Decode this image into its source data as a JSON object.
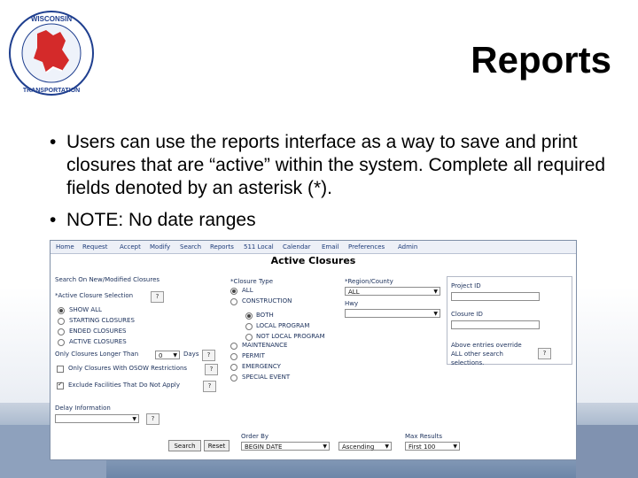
{
  "slide": {
    "title": "Reports",
    "bullets": [
      "Users can use the reports interface as a way to save and print closures that are “active” within the system. Complete all required fields denoted by an asterisk (*).",
      "NOTE:  No date ranges"
    ],
    "logo": {
      "text": "WISCONSIN DEPARTMENT OF TRANSPORTATION",
      "colors": {
        "state": "#d42a2a",
        "ring": "#1f3f8f"
      }
    }
  },
  "app": {
    "nav": [
      "Home",
      "Request",
      "Accept",
      "Modify",
      "Search",
      "Reports",
      "511 Local",
      "Calendar",
      "Email",
      "Preferences",
      "Admin"
    ],
    "page_title": "Active Closures",
    "search_on_label": "Search On New/Modified Closures",
    "active_selection_label": "*Active Closure Selection",
    "closure_options": [
      "SHOW ALL",
      "STARTING CLOSURES",
      "ENDED CLOSURES",
      "ACTIVE CLOSURES"
    ],
    "longer_than_label": "Only Closures Longer Than",
    "longer_than_value": "0",
    "days_label": "Days",
    "osow_label": "Only Closures With OSOW Restrictions",
    "exclude_label": "Exclude Facilities That Do Not Apply",
    "delay_label": "Delay Information",
    "search_button": "Search",
    "reset_button": "Reset",
    "closure_type_label": "*Closure Type",
    "closure_types": [
      "ALL",
      "CONSTRUCTION"
    ],
    "construction_sub": [
      "BOTH",
      "LOCAL PROGRAM",
      "NOT LOCAL PROGRAM"
    ],
    "other_types": [
      "MAINTENANCE",
      "PERMIT",
      "EMERGENCY",
      "SPECIAL EVENT"
    ],
    "region_label": "*Region/County",
    "region_value": "ALL",
    "hwy_label": "Hwy",
    "project_label": "Project ID",
    "closure_id_label": "Closure ID",
    "override_note": "Above entries override ALL other search selections.",
    "order_by_label": "Order By",
    "order_by_value": "BEGIN DATE",
    "direction_value": "Ascending",
    "max_results_label": "Max Results",
    "max_results_value": "First 100",
    "help": "?"
  }
}
